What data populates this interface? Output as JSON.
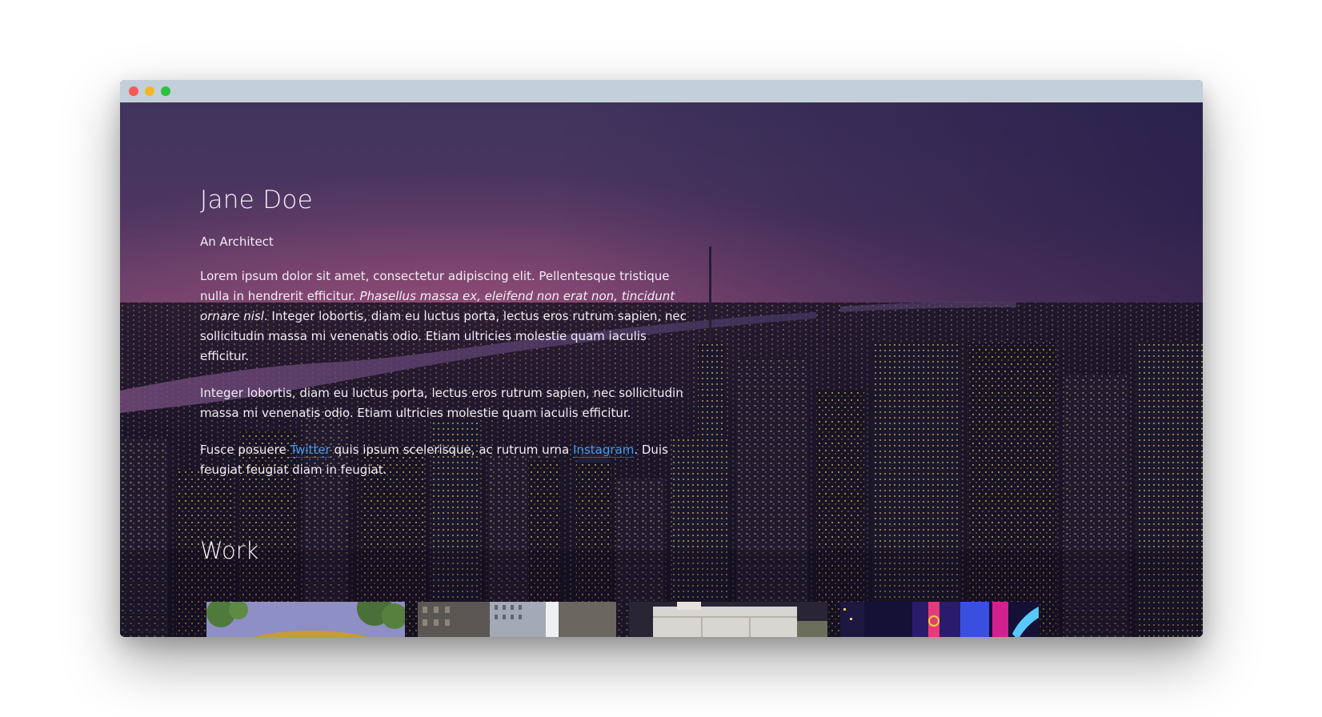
{
  "window": {
    "controls": [
      "close",
      "minimize",
      "maximize"
    ]
  },
  "profile": {
    "name": "Jane Doe",
    "subtitle": "An Architect",
    "para1_a": "Lorem ipsum dolor sit amet, consectetur adipiscing elit. Pellentesque tristique nulla in hendrerit efficitur. ",
    "para1_em": "Phasellus massa ex, eleifend non erat non, tincidunt ornare nisl",
    "para1_b": ". Integer lobortis, diam eu luctus porta, lectus eros rutrum sapien, nec sollicitudin massa mi venenatis odio. Etiam ultricies molestie quam iaculis efficitur.",
    "para2": "Integer lobortis, diam eu luctus porta, lectus eros rutrum sapien, nec sollicitudin massa mi venenatis odio. Etiam ultricies molestie quam iaculis efficitur.",
    "para3_a": "Fusce posuere ",
    "link_twitter": "Twitter",
    "para3_b": " quis ipsum scelerisque, ac rutrum urna ",
    "link_instagram": "Instagram",
    "para3_c": ". Duis feugiat feugiat diam in feugiat."
  },
  "work": {
    "title": "Work",
    "thumbnails": [
      "arena-icon",
      "skyscrapers-icon",
      "building-icon",
      "neon-icon"
    ]
  },
  "colors": {
    "link": "#3f9cf0",
    "titlebar": "#c3cfd9",
    "close": "#f45a55",
    "minimize": "#f2b824",
    "maximize": "#2ac240"
  }
}
